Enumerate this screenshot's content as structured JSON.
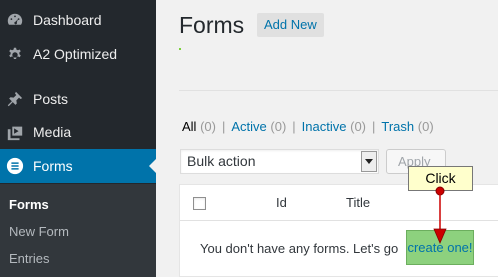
{
  "sidebar": {
    "items": [
      {
        "label": "Dashboard",
        "icon": "dashboard-icon"
      },
      {
        "label": "A2 Optimized",
        "icon": "gear-icon"
      },
      {
        "label": "Posts",
        "icon": "pushpin-icon"
      },
      {
        "label": "Media",
        "icon": "media-icon"
      },
      {
        "label": "Forms",
        "icon": "forms-icon",
        "active": true
      }
    ],
    "submenu": [
      "Forms",
      "New Form",
      "Entries"
    ]
  },
  "header": {
    "title": "Forms",
    "add_new": "Add New"
  },
  "views": {
    "all": "All",
    "all_count": "(0)",
    "active": "Active",
    "active_count": "(0)",
    "inactive": "Inactive",
    "inactive_count": "(0)",
    "trash": "Trash",
    "trash_count": "(0)",
    "separator": "|"
  },
  "bulk": {
    "selected": "Bulk action",
    "apply": "Apply"
  },
  "table": {
    "columns": [
      "Id",
      "Title"
    ],
    "empty_message": "You don't have any forms. Let's go",
    "create_link": "create one!"
  },
  "callout": {
    "label": "Click"
  },
  "colors": {
    "sidebar_bg": "#23282d",
    "active_bg": "#0073aa",
    "link": "#0073aa",
    "highlight": "#8dd17e",
    "callout_bg": "#ffffcc",
    "arrow": "#cc0000"
  }
}
